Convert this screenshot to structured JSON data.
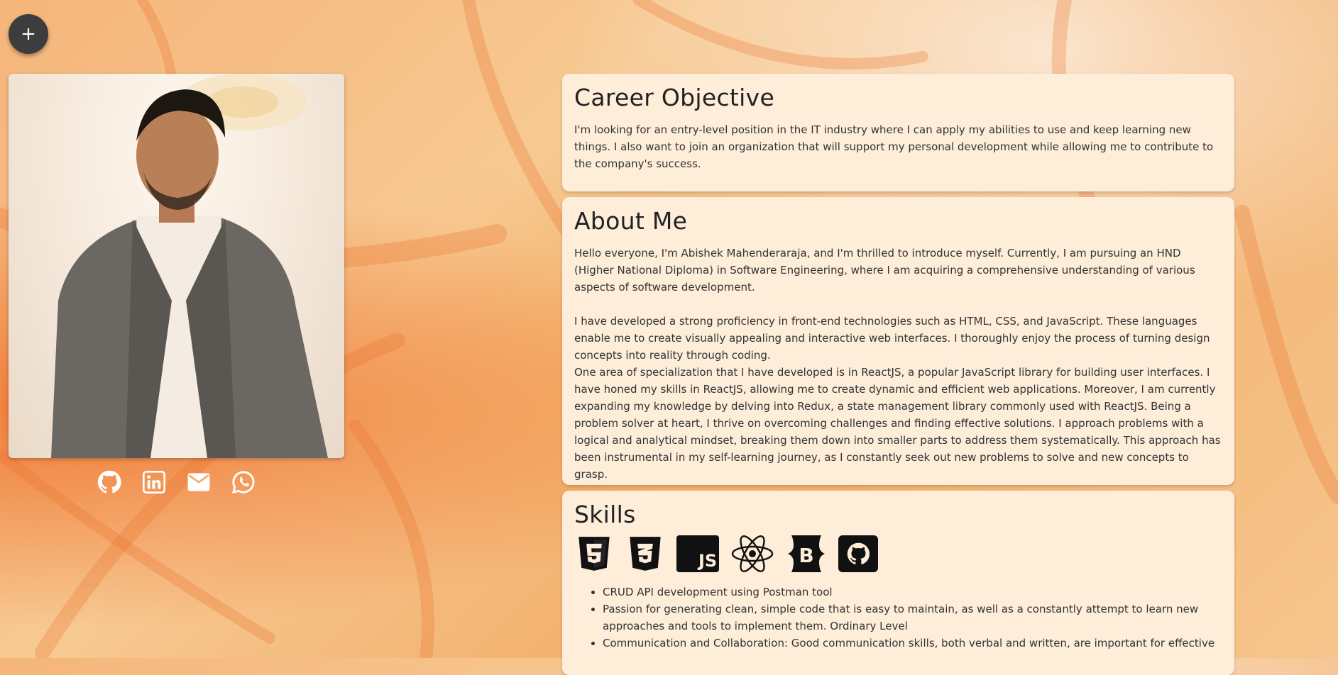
{
  "fab": {
    "label": "+"
  },
  "profile": {
    "photo_alt": "Abishek Mahenderaraja"
  },
  "social": [
    {
      "name": "GitHub",
      "icon": "github-icon"
    },
    {
      "name": "LinkedIn",
      "icon": "linkedin-icon"
    },
    {
      "name": "Email",
      "icon": "email-icon"
    },
    {
      "name": "WhatsApp",
      "icon": "whatsapp-icon"
    }
  ],
  "career": {
    "title": "Career Objective",
    "text": "I'm looking for an entry-level position in the IT industry where I can apply my abilities to use and keep learning new things. I also want to join an organization that will support my personal development while allowing me to contribute to the company's success."
  },
  "about": {
    "title": "About Me",
    "p1": "Hello everyone, I'm Abishek Mahenderaraja, and I'm thrilled to introduce myself. Currently, I am pursuing an HND (Higher National Diploma) in Software Engineering, where I am acquiring a comprehensive understanding of various aspects of software development.",
    "p2": "I have developed a strong proficiency in front-end technologies such as HTML, CSS, and JavaScript. These languages enable me to create visually appealing and interactive web interfaces. I thoroughly enjoy the process of turning design concepts into reality through coding.",
    "p3": "One area of specialization that I have developed is in ReactJS, a popular JavaScript library for building user interfaces. I have honed my skills in ReactJS, allowing me to create dynamic and efficient web applications. Moreover, I am currently expanding my knowledge by delving into Redux, a state management library commonly used with ReactJS. Being a problem solver at heart, I thrive on overcoming challenges and finding effective solutions. I approach problems with a logical and analytical mindset, breaking them down into smaller parts to address them systematically. This approach has been instrumental in my self-learning journey, as I constantly seek out new problems to solve and new concepts to grasp."
  },
  "skills": {
    "title": "Skills",
    "icons": [
      "html5-icon",
      "css3-icon",
      "javascript-icon",
      "react-icon",
      "bootstrap-icon",
      "github-icon"
    ],
    "js_badge": "JS",
    "bs_badge": "B",
    "items": [
      "CRUD API development using Postman tool",
      "Passion for generating clean, simple code that is easy to maintain, as well as a constantly attempt to learn new approaches and tools to implement them. Ordinary Level",
      "Communication and Collaboration: Good communication skills, both verbal and written, are important for effective"
    ]
  }
}
